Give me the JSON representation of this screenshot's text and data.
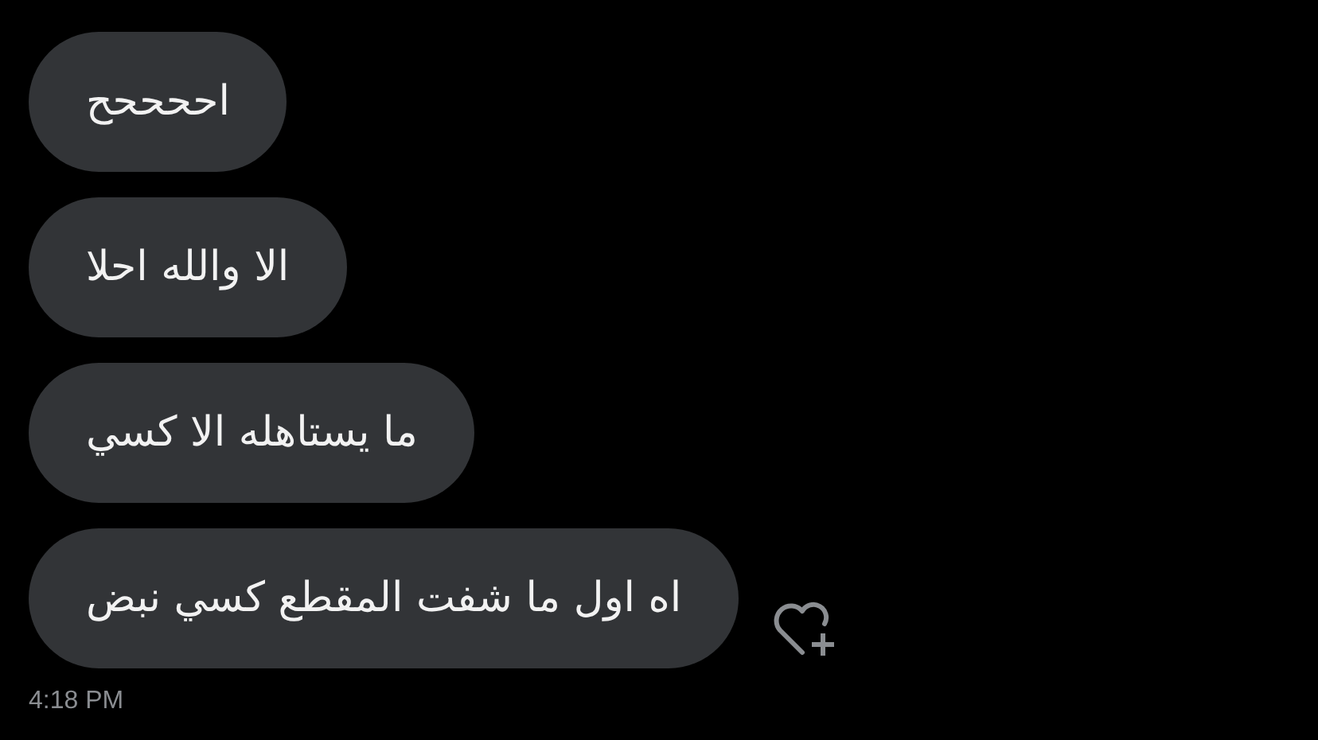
{
  "messages": [
    {
      "text": "اححححح",
      "reaction_button": false
    },
    {
      "text": "الا والله احلا",
      "reaction_button": false
    },
    {
      "text": "ما يستاهله الا كسي",
      "reaction_button": false
    },
    {
      "text": "اه اول ما شفت المقطع كسي نبض",
      "reaction_button": true
    }
  ],
  "timestamp": "4:18 PM"
}
